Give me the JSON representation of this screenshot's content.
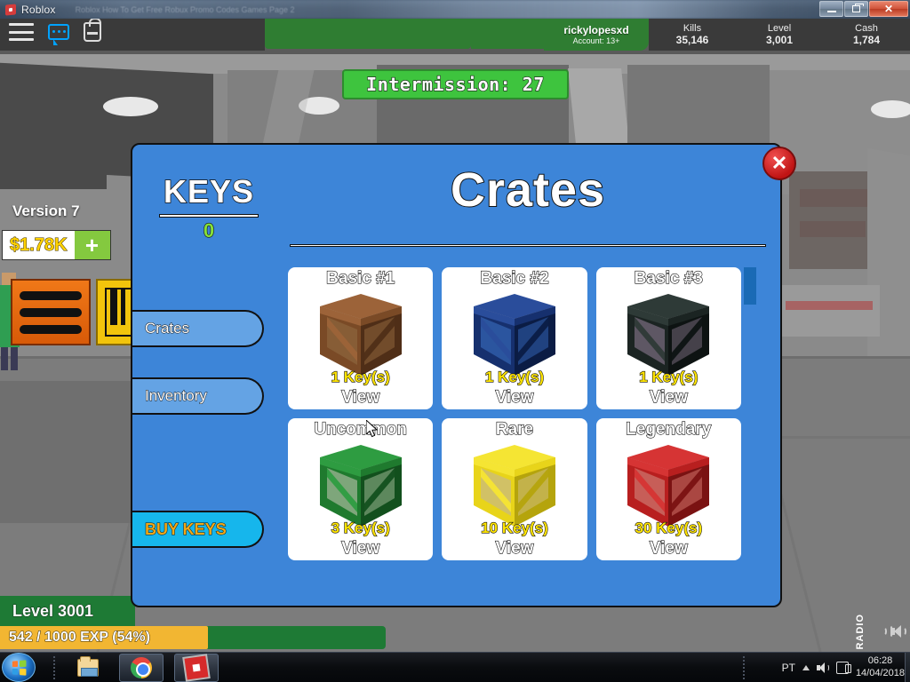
{
  "window": {
    "app_title": "Roblox",
    "ghost_tabs": "Roblox How To Get Free Robux Promo Codes Games Page 2",
    "controls": {
      "minimize": "–",
      "restore": "❐",
      "close": "✕"
    }
  },
  "game_hud": {
    "icons": {
      "menu": "hamburger-icon",
      "chat": "chat-icon",
      "backpack": "backpack-icon"
    },
    "player": {
      "username": "rickylopesxd",
      "account": "Account: 13+"
    },
    "stats": [
      {
        "label": "Kills",
        "value": "35,146"
      },
      {
        "label": "Level",
        "value": "3,001"
      },
      {
        "label": "Cash",
        "value": "1,784"
      }
    ],
    "announcement": "Intermission: 27",
    "version": "Version 7",
    "cash_display": "$1.78K",
    "cash_add": "+",
    "level_label": "Level 3001",
    "exp_label": "542 / 1000 EXP (54%)",
    "exp_percent": 54,
    "radio_label": "RADIO"
  },
  "modal": {
    "title": "Crates",
    "close_label": "✕",
    "keys_heading": "KEYS",
    "keys_count": "0",
    "tabs": [
      {
        "label": "Crates",
        "selected": true
      },
      {
        "label": "Inventory",
        "selected": false
      }
    ],
    "buy_keys_label": "BUY KEYS",
    "crates": [
      {
        "name": "Basic #1",
        "cost": "1 Key(s)",
        "action": "View",
        "color": "#7a4a26",
        "light": "#9c6339",
        "dark": "#4f2e17",
        "panel": "#8a6039"
      },
      {
        "name": "Basic #2",
        "cost": "1 Key(s)",
        "action": "View",
        "color": "#16306e",
        "light": "#2a4d9b",
        "dark": "#0b1c44",
        "panel": "#2f5ca8"
      },
      {
        "name": "Basic #3",
        "cost": "1 Key(s)",
        "action": "View",
        "color": "#1b2422",
        "light": "#2e3a37",
        "dark": "#0d1312",
        "panel": "#6a6070"
      },
      {
        "name": "Uncommon",
        "cost": "3 Key(s)",
        "action": "View",
        "color": "#1f7a2e",
        "light": "#2e9c41",
        "dark": "#12501d",
        "panel": "#8fae88"
      },
      {
        "name": "Rare",
        "cost": "10 Key(s)",
        "action": "View",
        "color": "#e8d41a",
        "light": "#f5e533",
        "dark": "#b5a40c",
        "panel": "#cdbd74"
      },
      {
        "name": "Legendary",
        "cost": "30 Key(s)",
        "action": "View",
        "color": "#b81f1f",
        "light": "#d63434",
        "dark": "#7a1212",
        "panel": "#c96a63"
      }
    ]
  },
  "taskbar": {
    "start": "start-orb",
    "items": [
      {
        "name": "explorer",
        "active": false
      },
      {
        "name": "chrome",
        "active": true
      },
      {
        "name": "roblox",
        "active": true
      }
    ],
    "tray": {
      "language": "PT",
      "time": "06:28",
      "date": "14/04/2018"
    }
  }
}
